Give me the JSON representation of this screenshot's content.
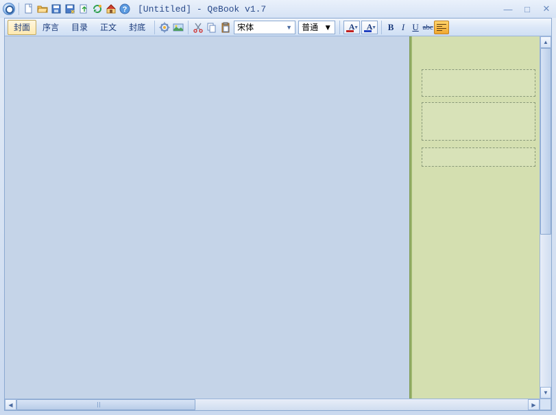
{
  "title": "[Untitled] - QeBook v1.7",
  "titlebar_icons": [
    "new",
    "open",
    "save",
    "save-as",
    "export",
    "refresh",
    "home",
    "help"
  ],
  "tabs": [
    {
      "id": "cover",
      "label": "封面",
      "active": true
    },
    {
      "id": "preface",
      "label": "序言",
      "active": false
    },
    {
      "id": "toc",
      "label": "目录",
      "active": false
    },
    {
      "id": "body",
      "label": "正文",
      "active": false
    },
    {
      "id": "back",
      "label": "封底",
      "active": false
    }
  ],
  "toolbar": {
    "font_name": "宋体",
    "font_caliber": "普通",
    "text_color": "#c02020",
    "highlight_color": "#2040c0",
    "bold": "B",
    "italic": "I",
    "underline": "U",
    "strike": "abc"
  },
  "window_controls": {
    "min": "—",
    "max": "□",
    "close": "✕"
  }
}
